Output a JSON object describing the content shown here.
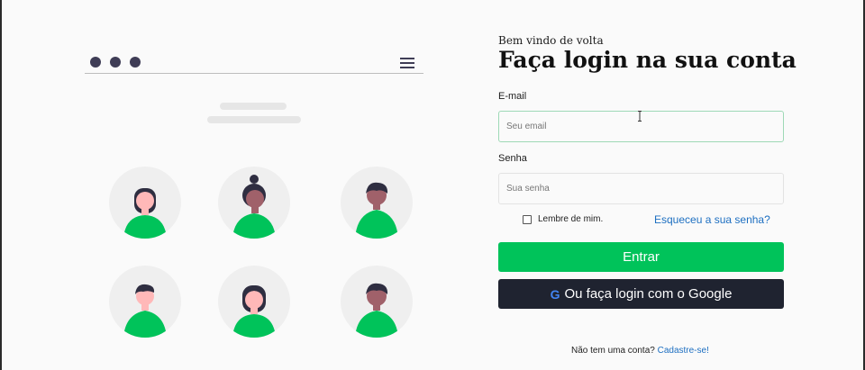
{
  "form": {
    "welcome": "Bem vindo de volta",
    "title": "Faça login na sua conta",
    "email_label": "E-mail",
    "email_placeholder": "Seu email",
    "password_label": "Senha",
    "password_placeholder": "Sua senha",
    "remember_label": "Lembre de mim.",
    "forgot_link": "Esqueceu a sua senha?",
    "submit_label": "Entrar",
    "google_label": "Ou faça login com o Google",
    "google_icon": "G",
    "signup_prompt": "Não tem uma conta?",
    "signup_link": "Cadastre-se!"
  },
  "icons": {
    "menu": "hamburger-menu-icon",
    "window_controls": "three-dots-icon",
    "google": "google-g-icon",
    "cursor": "text-cursor-icon"
  },
  "colors": {
    "primary": "#00c35a",
    "dark_button": "#1f2330",
    "link": "#1d6fc1",
    "illustration_dark": "#3f3d56",
    "avatar_bg": "#efefef"
  }
}
